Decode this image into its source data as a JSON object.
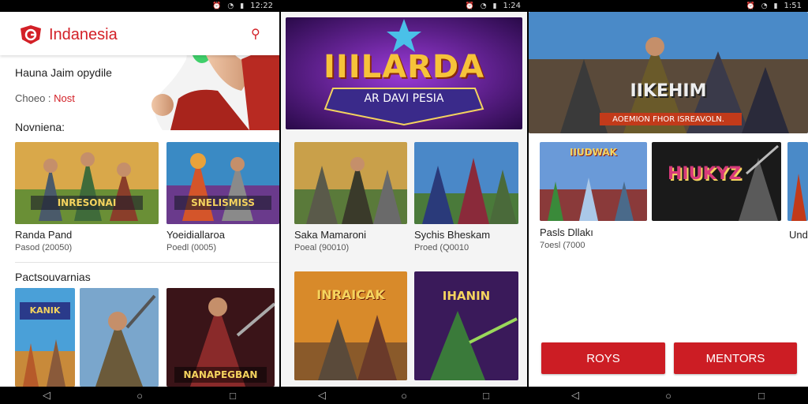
{
  "screen1": {
    "status_time": "12:22",
    "brand": "Indanesia",
    "subtitle": "Hauna Jaim opydile",
    "choose_label": "Choeo :",
    "choose_value": "Nost",
    "section1": "Novniena:",
    "cards": [
      {
        "banner": "INRESONAI",
        "title": "Randa Pand",
        "sub": "Pasod (20050)"
      },
      {
        "banner": "SNELISMISS",
        "title": "Yoeidiallaroa",
        "sub": "Poedl (0005)"
      }
    ],
    "section2": "Pactsouvarnias",
    "row2": [
      {
        "banner": "KANIK"
      },
      {
        "banner": ""
      },
      {
        "banner": "NANAPEGBAN"
      }
    ]
  },
  "screen2": {
    "status_time": "1:24",
    "banner_title": "IIILARDA",
    "banner_subtitle": "AR DAVI PESIA",
    "cards": [
      {
        "title": "Saka Mamaroni",
        "sub": "Poeal (90010)"
      },
      {
        "title": "Sychis Bheskam",
        "sub": "Proed (Q0010"
      }
    ],
    "row2": [
      {
        "banner": "INRAICAK"
      },
      {
        "banner": "IHANIN"
      }
    ]
  },
  "screen3": {
    "status_time": "1:51",
    "banner_title": "IIKEHIM",
    "banner_caption": "AOEMION FHOR ISREAVOLN.",
    "cards": [
      {
        "banner": "IIUDWAK",
        "title": "Pasls Dllakı",
        "sub": "7oesl (7000"
      },
      {
        "banner": "HIUKYZ",
        "title": "",
        "sub": ""
      },
      {
        "banner": "",
        "title": "Und",
        "sub": ""
      }
    ],
    "buttons": {
      "left": "ROYS",
      "right": "MENTORS"
    }
  },
  "nav": {
    "back": "◁",
    "home": "○",
    "recent": "□"
  },
  "colors": {
    "accent": "#d32027"
  }
}
